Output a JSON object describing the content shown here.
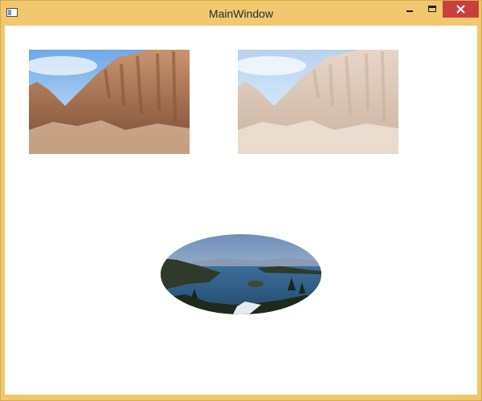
{
  "window": {
    "title": "MainWindow",
    "controls": {
      "minimize": "minimize-icon",
      "maximize": "maximize-icon",
      "close": "close-icon"
    }
  },
  "content": {
    "images": [
      {
        "name": "canyon-photo",
        "opacity": 1.0
      },
      {
        "name": "canyon-photo-faded",
        "opacity": 0.5
      },
      {
        "name": "lake-photo-ellipse",
        "clip": "ellipse"
      }
    ]
  },
  "colors": {
    "frame": "#f2c86f",
    "close_button": "#c7403c",
    "sky": "#7fb3e6",
    "rock": "#b87a55",
    "lake": "#4a7fb0"
  }
}
